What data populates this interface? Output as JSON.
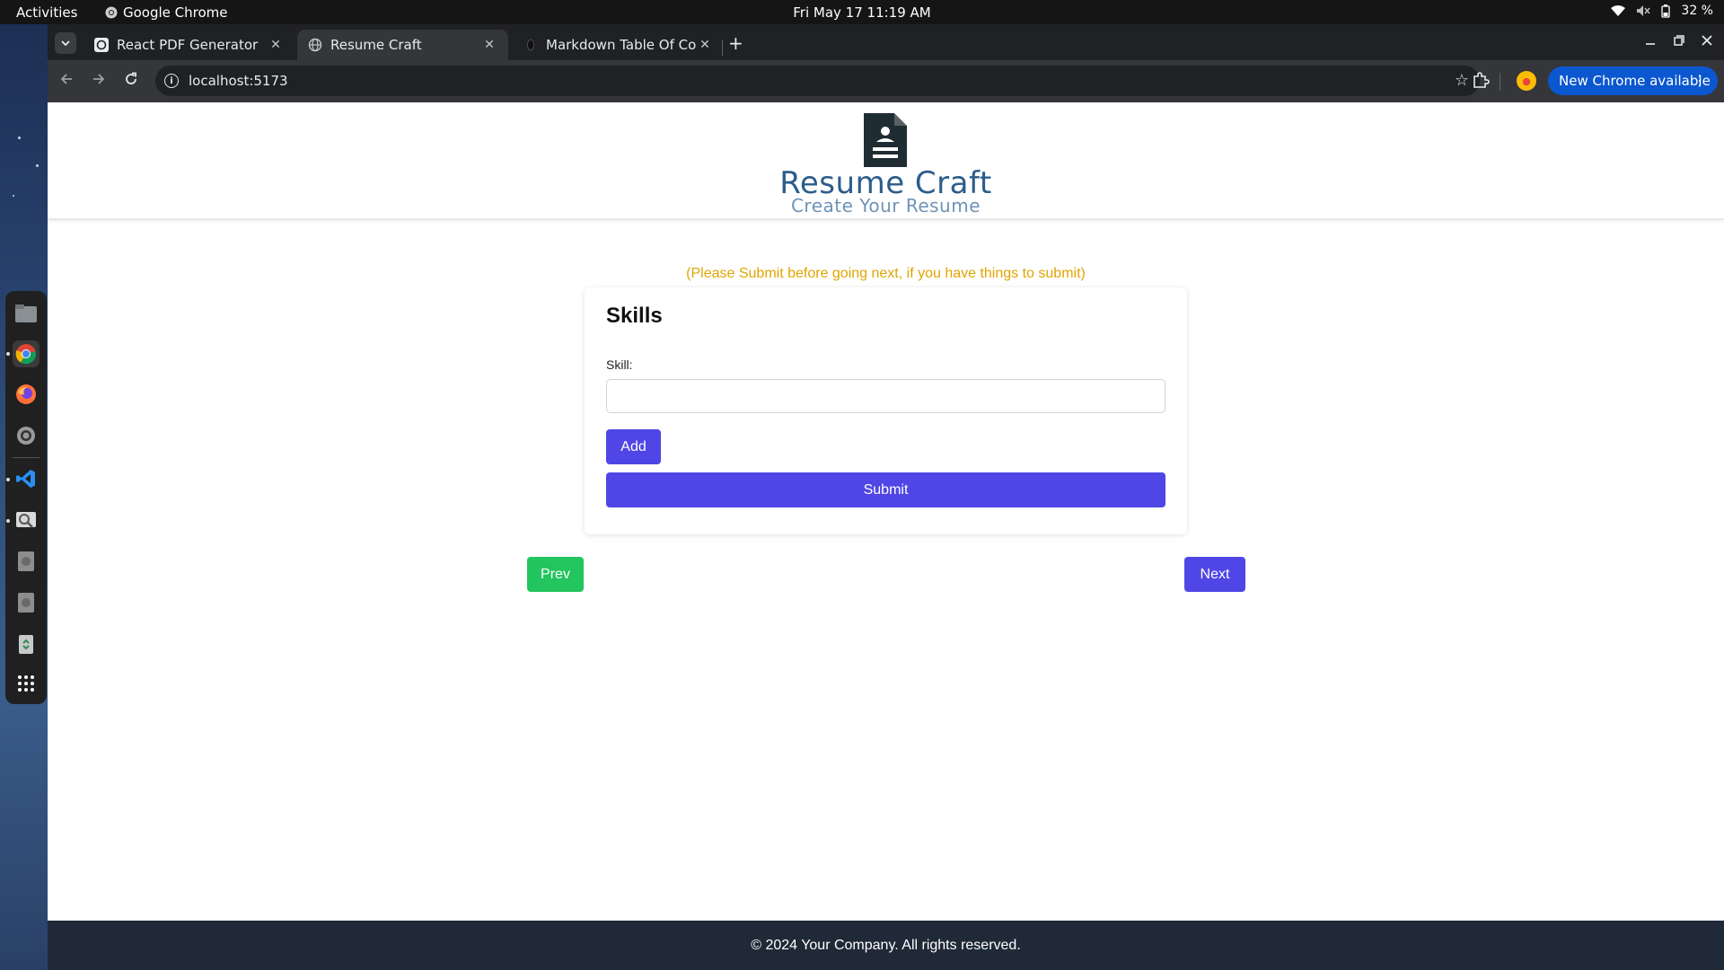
{
  "system": {
    "activities": "Activities",
    "app_name": "Google Chrome",
    "clock": "Fri May 17  11:19 AM",
    "battery": "32 %"
  },
  "browser": {
    "tabs": [
      {
        "title": "React PDF Generator",
        "active": false
      },
      {
        "title": "Resume Craft",
        "active": true
      },
      {
        "title": "Markdown Table Of Con",
        "active": false
      }
    ],
    "url": "localhost:5173",
    "update_label": "New Chrome available"
  },
  "header": {
    "brand": "Resume Craft",
    "tagline": "Create Your Resume"
  },
  "page": {
    "note": "(Please Submit before going next, if you have things to submit)",
    "section_title": "Skills",
    "skill_label": "Skill:",
    "skill_value": "",
    "add_label": "Add",
    "submit_label": "Submit",
    "prev_label": "Prev",
    "next_label": "Next"
  },
  "footer": {
    "text": "© 2024 Your Company. All rights reserved."
  },
  "colors": {
    "primary": "#4f46e5",
    "success": "#22c55e",
    "warning_text": "#e0a400",
    "brand": "#2b5d8a",
    "footer_bg": "#1f2937"
  }
}
